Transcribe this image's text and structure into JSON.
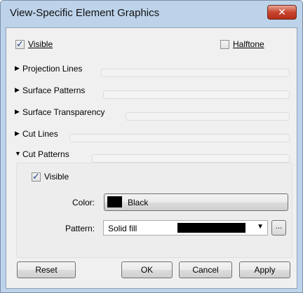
{
  "window": {
    "title": "View-Specific Element Graphics",
    "close_symbol": "✕"
  },
  "visible": {
    "label": "Visible",
    "checked": true
  },
  "halftone": {
    "label": "Halftone",
    "checked": false
  },
  "sections": [
    {
      "label": "Projection Lines",
      "expanded": false
    },
    {
      "label": "Surface Patterns",
      "expanded": false
    },
    {
      "label": "Surface Transparency",
      "expanded": false
    },
    {
      "label": "Cut Lines",
      "expanded": false
    },
    {
      "label": "Cut Patterns",
      "expanded": true
    }
  ],
  "cut_patterns": {
    "visible": {
      "label": "Visible",
      "checked": true
    },
    "color": {
      "label": "Color:",
      "value": "Black",
      "swatch": "#000000"
    },
    "pattern": {
      "label": "Pattern:",
      "value": "Solid fill",
      "more": "..."
    }
  },
  "buttons": {
    "reset": "Reset",
    "ok": "OK",
    "cancel": "Cancel",
    "apply": "Apply"
  }
}
